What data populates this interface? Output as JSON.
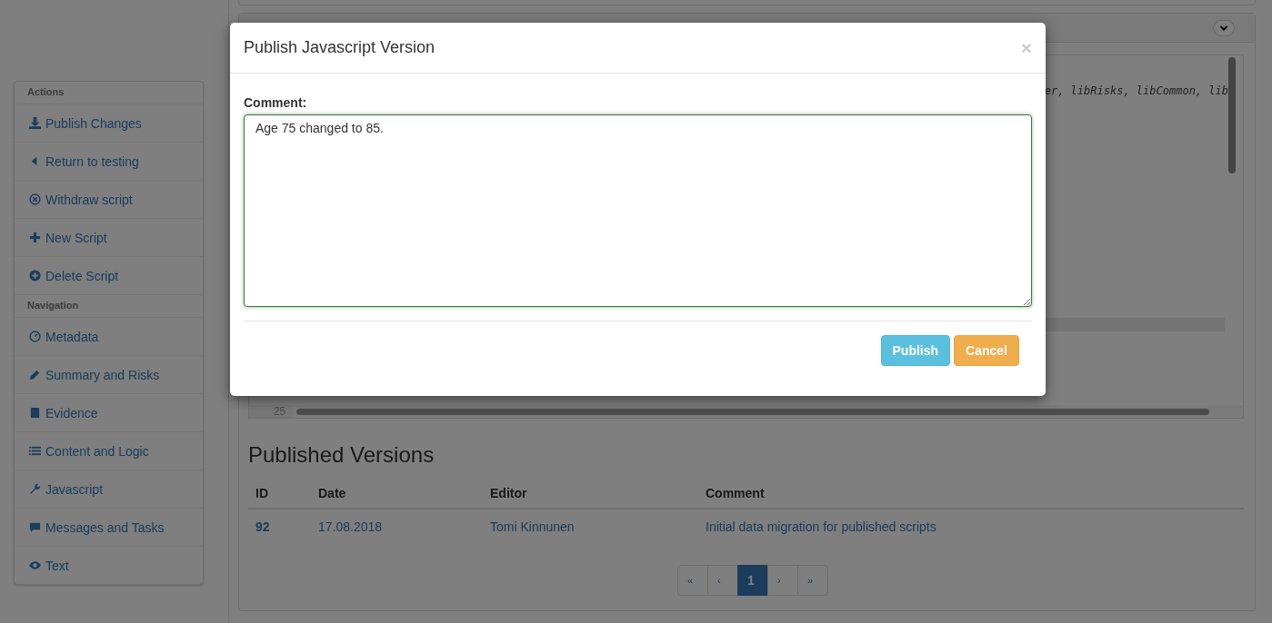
{
  "sidebar": {
    "groups": [
      {
        "heading": "Actions",
        "items": [
          {
            "label": "Publish Changes"
          },
          {
            "label": "Return to testing"
          },
          {
            "label": "Withdraw script"
          },
          {
            "label": "New Script"
          },
          {
            "label": "Delete Script"
          }
        ]
      },
      {
        "heading": "Navigation",
        "items": [
          {
            "label": "Metadata"
          },
          {
            "label": "Summary and Risks"
          },
          {
            "label": "Evidence"
          },
          {
            "label": "Content and Logic"
          },
          {
            "label": "Javascript"
          },
          {
            "label": "Messages and Tasks"
          },
          {
            "label": "Text"
          }
        ]
      }
    ]
  },
  "editor": {
    "code_fragment": "er, libRisks, libCommon, lib",
    "line_number": "25"
  },
  "published_versions": {
    "title": "Published Versions",
    "columns": [
      "ID",
      "Date",
      "Editor",
      "Comment"
    ],
    "rows": [
      {
        "id": "92",
        "date": "17.08.2018",
        "editor": "Tomi Kinnunen",
        "comment": "Initial data migration for published scripts"
      }
    ],
    "pagination": [
      {
        "label": "«",
        "selected": false
      },
      {
        "label": "‹",
        "selected": false
      },
      {
        "label": "1",
        "selected": true
      },
      {
        "label": "›",
        "selected": false
      },
      {
        "label": "»",
        "selected": false
      }
    ]
  },
  "modal": {
    "title": "Publish Javascript Version",
    "close": "×",
    "field_label": "Comment:",
    "value": "Age 75 changed to 85.",
    "buttons": [
      {
        "label": "Publish",
        "kind": "info"
      },
      {
        "label": "Cancel",
        "kind": "warning"
      }
    ]
  }
}
